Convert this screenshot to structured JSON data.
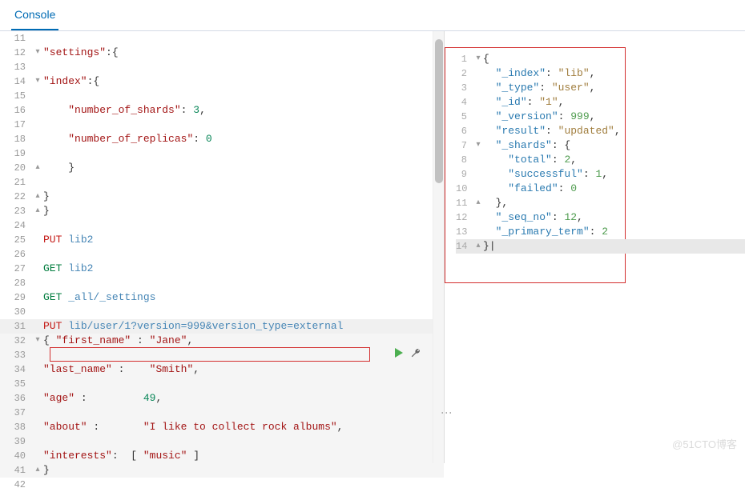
{
  "tabs": {
    "console": "Console"
  },
  "watermark": "@51CTO博客",
  "editor_left": {
    "lines": [
      {
        "n": 11,
        "fold": "",
        "html": ""
      },
      {
        "n": 12,
        "fold": "▾",
        "tokens": [
          [
            "kw-key",
            "\"settings\""
          ],
          [
            "kw-punc",
            ":{"
          ]
        ]
      },
      {
        "n": 13,
        "fold": "",
        "html": ""
      },
      {
        "n": 14,
        "fold": "▾",
        "tokens": [
          [
            "kw-key",
            "\"index\""
          ],
          [
            "kw-punc",
            ":{"
          ]
        ]
      },
      {
        "n": 15,
        "fold": "",
        "html": ""
      },
      {
        "n": 16,
        "fold": "",
        "indent": "    ",
        "tokens": [
          [
            "kw-key",
            "\"number_of_shards\""
          ],
          [
            "kw-punc",
            ": "
          ],
          [
            "kw-number",
            "3"
          ],
          [
            "kw-punc",
            ","
          ]
        ]
      },
      {
        "n": 17,
        "fold": "",
        "html": ""
      },
      {
        "n": 18,
        "fold": "",
        "indent": "    ",
        "tokens": [
          [
            "kw-key",
            "\"number_of_replicas\""
          ],
          [
            "kw-punc",
            ": "
          ],
          [
            "kw-number",
            "0"
          ]
        ]
      },
      {
        "n": 19,
        "fold": "",
        "html": ""
      },
      {
        "n": 20,
        "fold": "▴",
        "indent": "    ",
        "tokens": [
          [
            "kw-punc",
            "}"
          ]
        ]
      },
      {
        "n": 21,
        "fold": "",
        "html": ""
      },
      {
        "n": 22,
        "fold": "▴",
        "tokens": [
          [
            "kw-punc",
            "}"
          ]
        ]
      },
      {
        "n": 23,
        "fold": "▴",
        "tokens": [
          [
            "kw-punc",
            "}"
          ]
        ]
      },
      {
        "n": 24,
        "fold": "",
        "html": ""
      },
      {
        "n": 25,
        "fold": "",
        "tokens": [
          [
            "kw-method-put",
            "PUT"
          ],
          [
            "",
            " "
          ],
          [
            "kw-url",
            "lib2"
          ]
        ]
      },
      {
        "n": 26,
        "fold": "",
        "html": ""
      },
      {
        "n": 27,
        "fold": "",
        "tokens": [
          [
            "kw-method-get",
            "GET"
          ],
          [
            "",
            " "
          ],
          [
            "kw-url",
            "lib2"
          ]
        ]
      },
      {
        "n": 28,
        "fold": "",
        "html": ""
      },
      {
        "n": 29,
        "fold": "",
        "tokens": [
          [
            "kw-method-get",
            "GET"
          ],
          [
            "",
            " "
          ],
          [
            "kw-url",
            "_all/_settings"
          ]
        ]
      },
      {
        "n": 30,
        "fold": "",
        "html": ""
      },
      {
        "n": 31,
        "fold": "",
        "current": true,
        "tokens": [
          [
            "kw-method-put",
            "PUT"
          ],
          [
            "",
            " "
          ],
          [
            "kw-url",
            "lib/user/1?version=999&version_type=external"
          ]
        ]
      },
      {
        "n": 32,
        "fold": "▾",
        "sel": true,
        "tokens": [
          [
            "kw-punc",
            "{ "
          ],
          [
            "kw-key",
            "\"first_name\""
          ],
          [
            "kw-punc",
            " : "
          ],
          [
            "kw-string",
            "\"Jane\""
          ],
          [
            "kw-punc",
            ","
          ]
        ]
      },
      {
        "n": 33,
        "fold": "",
        "sel": true,
        "html": ""
      },
      {
        "n": 34,
        "fold": "",
        "sel": true,
        "tokens": [
          [
            "kw-key",
            "\"last_name\""
          ],
          [
            "kw-punc",
            " :    "
          ],
          [
            "kw-string",
            "\"Smith\""
          ],
          [
            "kw-punc",
            ","
          ]
        ]
      },
      {
        "n": 35,
        "fold": "",
        "sel": true,
        "html": ""
      },
      {
        "n": 36,
        "fold": "",
        "sel": true,
        "tokens": [
          [
            "kw-key",
            "\"age\""
          ],
          [
            "kw-punc",
            " :         "
          ],
          [
            "kw-number",
            "49"
          ],
          [
            "kw-punc",
            ","
          ]
        ]
      },
      {
        "n": 37,
        "fold": "",
        "sel": true,
        "html": ""
      },
      {
        "n": 38,
        "fold": "",
        "sel": true,
        "tokens": [
          [
            "kw-key",
            "\"about\""
          ],
          [
            "kw-punc",
            " :       "
          ],
          [
            "kw-string",
            "\"I like to collect rock albums\""
          ],
          [
            "kw-punc",
            ","
          ]
        ]
      },
      {
        "n": 39,
        "fold": "",
        "sel": true,
        "html": ""
      },
      {
        "n": 40,
        "fold": "",
        "sel": true,
        "tokens": [
          [
            "kw-key",
            "\"interests\""
          ],
          [
            "kw-punc",
            ":  [ "
          ],
          [
            "kw-string",
            "\"music\""
          ],
          [
            "kw-punc",
            " ]"
          ]
        ]
      },
      {
        "n": 41,
        "fold": "▴",
        "sel": true,
        "tokens": [
          [
            "kw-punc",
            "}"
          ]
        ]
      },
      {
        "n": 42,
        "fold": "",
        "html": ""
      }
    ]
  },
  "editor_right": {
    "lines": [
      {
        "n": 1,
        "fold": "▾",
        "tokens": [
          [
            "kw-punc",
            "{"
          ]
        ]
      },
      {
        "n": 2,
        "fold": "",
        "indent": "  ",
        "tokens": [
          [
            "r-key",
            "\"_index\""
          ],
          [
            "kw-punc",
            ": "
          ],
          [
            "r-str",
            "\"lib\""
          ],
          [
            "kw-punc",
            ","
          ]
        ]
      },
      {
        "n": 3,
        "fold": "",
        "indent": "  ",
        "tokens": [
          [
            "r-key",
            "\"_type\""
          ],
          [
            "kw-punc",
            ": "
          ],
          [
            "r-str",
            "\"user\""
          ],
          [
            "kw-punc",
            ","
          ]
        ]
      },
      {
        "n": 4,
        "fold": "",
        "indent": "  ",
        "tokens": [
          [
            "r-key",
            "\"_id\""
          ],
          [
            "kw-punc",
            ": "
          ],
          [
            "r-str",
            "\"1\""
          ],
          [
            "kw-punc",
            ","
          ]
        ]
      },
      {
        "n": 5,
        "fold": "",
        "indent": "  ",
        "tokens": [
          [
            "r-key",
            "\"_version\""
          ],
          [
            "kw-punc",
            ": "
          ],
          [
            "r-num",
            "999"
          ],
          [
            "kw-punc",
            ","
          ]
        ]
      },
      {
        "n": 6,
        "fold": "",
        "indent": "  ",
        "tokens": [
          [
            "r-key",
            "\"result\""
          ],
          [
            "kw-punc",
            ": "
          ],
          [
            "r-str",
            "\"updated\""
          ],
          [
            "kw-punc",
            ","
          ]
        ]
      },
      {
        "n": 7,
        "fold": "▾",
        "indent": "  ",
        "tokens": [
          [
            "r-key",
            "\"_shards\""
          ],
          [
            "kw-punc",
            ": {"
          ]
        ]
      },
      {
        "n": 8,
        "fold": "",
        "indent": "    ",
        "tokens": [
          [
            "r-key",
            "\"total\""
          ],
          [
            "kw-punc",
            ": "
          ],
          [
            "r-num",
            "2"
          ],
          [
            "kw-punc",
            ","
          ]
        ]
      },
      {
        "n": 9,
        "fold": "",
        "indent": "    ",
        "tokens": [
          [
            "r-key",
            "\"successful\""
          ],
          [
            "kw-punc",
            ": "
          ],
          [
            "r-num",
            "1"
          ],
          [
            "kw-punc",
            ","
          ]
        ]
      },
      {
        "n": 10,
        "fold": "",
        "indent": "    ",
        "tokens": [
          [
            "r-key",
            "\"failed\""
          ],
          [
            "kw-punc",
            ": "
          ],
          [
            "r-num",
            "0"
          ]
        ]
      },
      {
        "n": 11,
        "fold": "▴",
        "indent": "  ",
        "tokens": [
          [
            "kw-punc",
            "},"
          ]
        ]
      },
      {
        "n": 12,
        "fold": "",
        "indent": "  ",
        "tokens": [
          [
            "r-key",
            "\"_seq_no\""
          ],
          [
            "kw-punc",
            ": "
          ],
          [
            "r-num",
            "12"
          ],
          [
            "kw-punc",
            ","
          ]
        ]
      },
      {
        "n": 13,
        "fold": "",
        "indent": "  ",
        "tokens": [
          [
            "r-key",
            "\"_primary_term\""
          ],
          [
            "kw-punc",
            ": "
          ],
          [
            "r-num",
            "2"
          ]
        ]
      },
      {
        "n": 14,
        "fold": "▴",
        "cursor": true,
        "tokens": [
          [
            "kw-punc",
            "}"
          ]
        ]
      }
    ]
  },
  "chart_data": {
    "type": "table",
    "request": {
      "method": "PUT",
      "path": "lib/user/1?version=999&version_type=external",
      "body": {
        "first_name": "Jane",
        "last_name": "Smith",
        "age": 49,
        "about": "I like to collect rock albums",
        "interests": [
          "music"
        ]
      }
    },
    "response": {
      "_index": "lib",
      "_type": "user",
      "_id": "1",
      "_version": 999,
      "result": "updated",
      "_shards": {
        "total": 2,
        "successful": 1,
        "failed": 0
      },
      "_seq_no": 12,
      "_primary_term": 2
    }
  }
}
